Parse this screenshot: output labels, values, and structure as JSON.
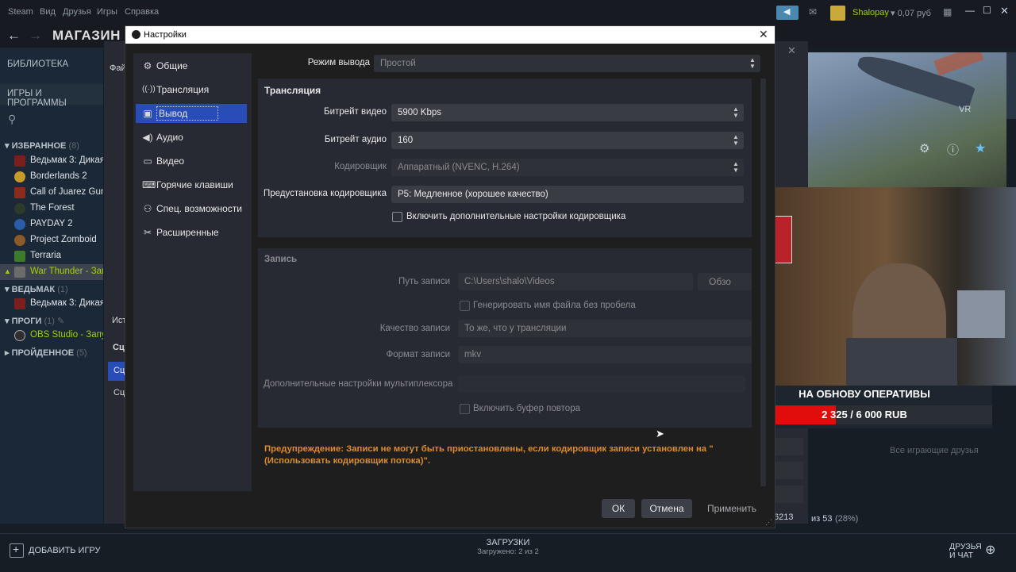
{
  "steam": {
    "menu": [
      "Steam",
      "Вид",
      "Друзья",
      "Игры",
      "Справка"
    ],
    "store_title": "МАГАЗИН",
    "user_name": "Shalopay",
    "wallet": "▾ 0,07 руб",
    "library_label": "БИБЛИОТЕКА",
    "games_and_programs": "ИГРЫ И ПРОГРАММЫ",
    "categories": {
      "favorites": {
        "name": "ИЗБРАННОЕ",
        "count": "(8)"
      },
      "witcher": {
        "name": "ВЕДЬМАК",
        "count": "(1)"
      },
      "programs": {
        "name": "ПРОГИ",
        "count": "(1)"
      },
      "completed": {
        "name": "ПРОЙДЕННОЕ",
        "count": "(5)"
      }
    },
    "favorites_games": [
      {
        "name": "Ведьмак 3: Дикая",
        "color": "#7a1e1e"
      },
      {
        "name": "Borderlands 2",
        "color": "#c79a2a"
      },
      {
        "name": "Call of Juarez Guns",
        "color": "#8a2b1d"
      },
      {
        "name": "The Forest",
        "color": "#2c3a2a"
      },
      {
        "name": "PAYDAY 2",
        "color": "#2a5ca8"
      },
      {
        "name": "Project Zomboid",
        "color": "#8a5a2a"
      },
      {
        "name": "Terraria",
        "color": "#3d7a2a"
      },
      {
        "name": "War Thunder - Запу",
        "color": "#6b6b6b"
      }
    ],
    "witcher_game": "Ведьмак 3: Дикая",
    "program": "OBS Studio - Запу",
    "partial_labels": [
      "Фай",
      "Ист",
      "Сц",
      "Сц",
      "Сц"
    ],
    "add_game": "ДОБАВИТЬ ИГРУ",
    "downloads_title": "ЗАГРУЗКИ",
    "downloads_sub": "Загружено: 2 из 2",
    "friends_chat_1": "ДРУЗЬЯ",
    "friends_chat_2": "И ЧАТ",
    "playing_friends": "Все играющие друзья",
    "stats_left": "6213",
    "stats_right": "из 53",
    "stats_pct": "(28%)",
    "vr_label": "VR"
  },
  "overlay": {
    "goal_text": "НА ОБНОВУ ОПЕРАТИВЫ",
    "goal_amount": "2 325 / 6 000 RUB",
    "goal_progress": 0.3875
  },
  "dialog": {
    "title": "Настройки",
    "sidebar": [
      {
        "label": "Общие",
        "icon": "⚙",
        "name": "general"
      },
      {
        "label": "Трансляция",
        "icon": "📶",
        "name": "stream"
      },
      {
        "label": "Вывод",
        "icon": "▣",
        "name": "output",
        "active": true
      },
      {
        "label": "Аудио",
        "icon": "🔊",
        "name": "audio"
      },
      {
        "label": "Видео",
        "icon": "▭",
        "name": "video"
      },
      {
        "label": "Горячие клавиши",
        "icon": "⌨",
        "name": "hotkeys"
      },
      {
        "label": "Спец. возможности",
        "icon": "♿",
        "name": "accessibility"
      },
      {
        "label": "Расширенные",
        "icon": "✂",
        "name": "advanced"
      }
    ],
    "output_mode": {
      "label": "Режим вывода",
      "value": "Простой"
    },
    "streaming": {
      "header": "Трансляция",
      "video_bitrate_label": "Битрейт видео",
      "video_bitrate": "5900 Kbps",
      "audio_bitrate_label": "Битрейт аудио",
      "audio_bitrate": "160",
      "encoder_label": "Кодировщик",
      "encoder": "Аппаратный (NVENC, H.264)",
      "preset_label": "Предустановка кодировщика",
      "preset": "P5: Медленное (хорошее качество)",
      "advanced_checkbox": "Включить дополнительные настройки кодировщика"
    },
    "recording": {
      "header": "Запись",
      "path_label": "Путь записи",
      "path": "C:\\Users\\shalo\\Videos",
      "browse": "Обзо",
      "nospace_checkbox": "Генерировать имя файла без пробела",
      "quality_label": "Качество записи",
      "quality": "То же, что у трансляции",
      "format_label": "Формат записи",
      "format": "mkv",
      "mux_label": "Дополнительные настройки мультиплексора",
      "mux": "",
      "replay_checkbox": "Включить буфер повтора"
    },
    "warning": "Предупреждение: Записи не могут быть приостановлены, если кодировщик записи установлен на \"(Использовать кодировщик потока)\".",
    "buttons": {
      "ok": "ОК",
      "cancel": "Отмена",
      "apply": "Применить"
    }
  }
}
